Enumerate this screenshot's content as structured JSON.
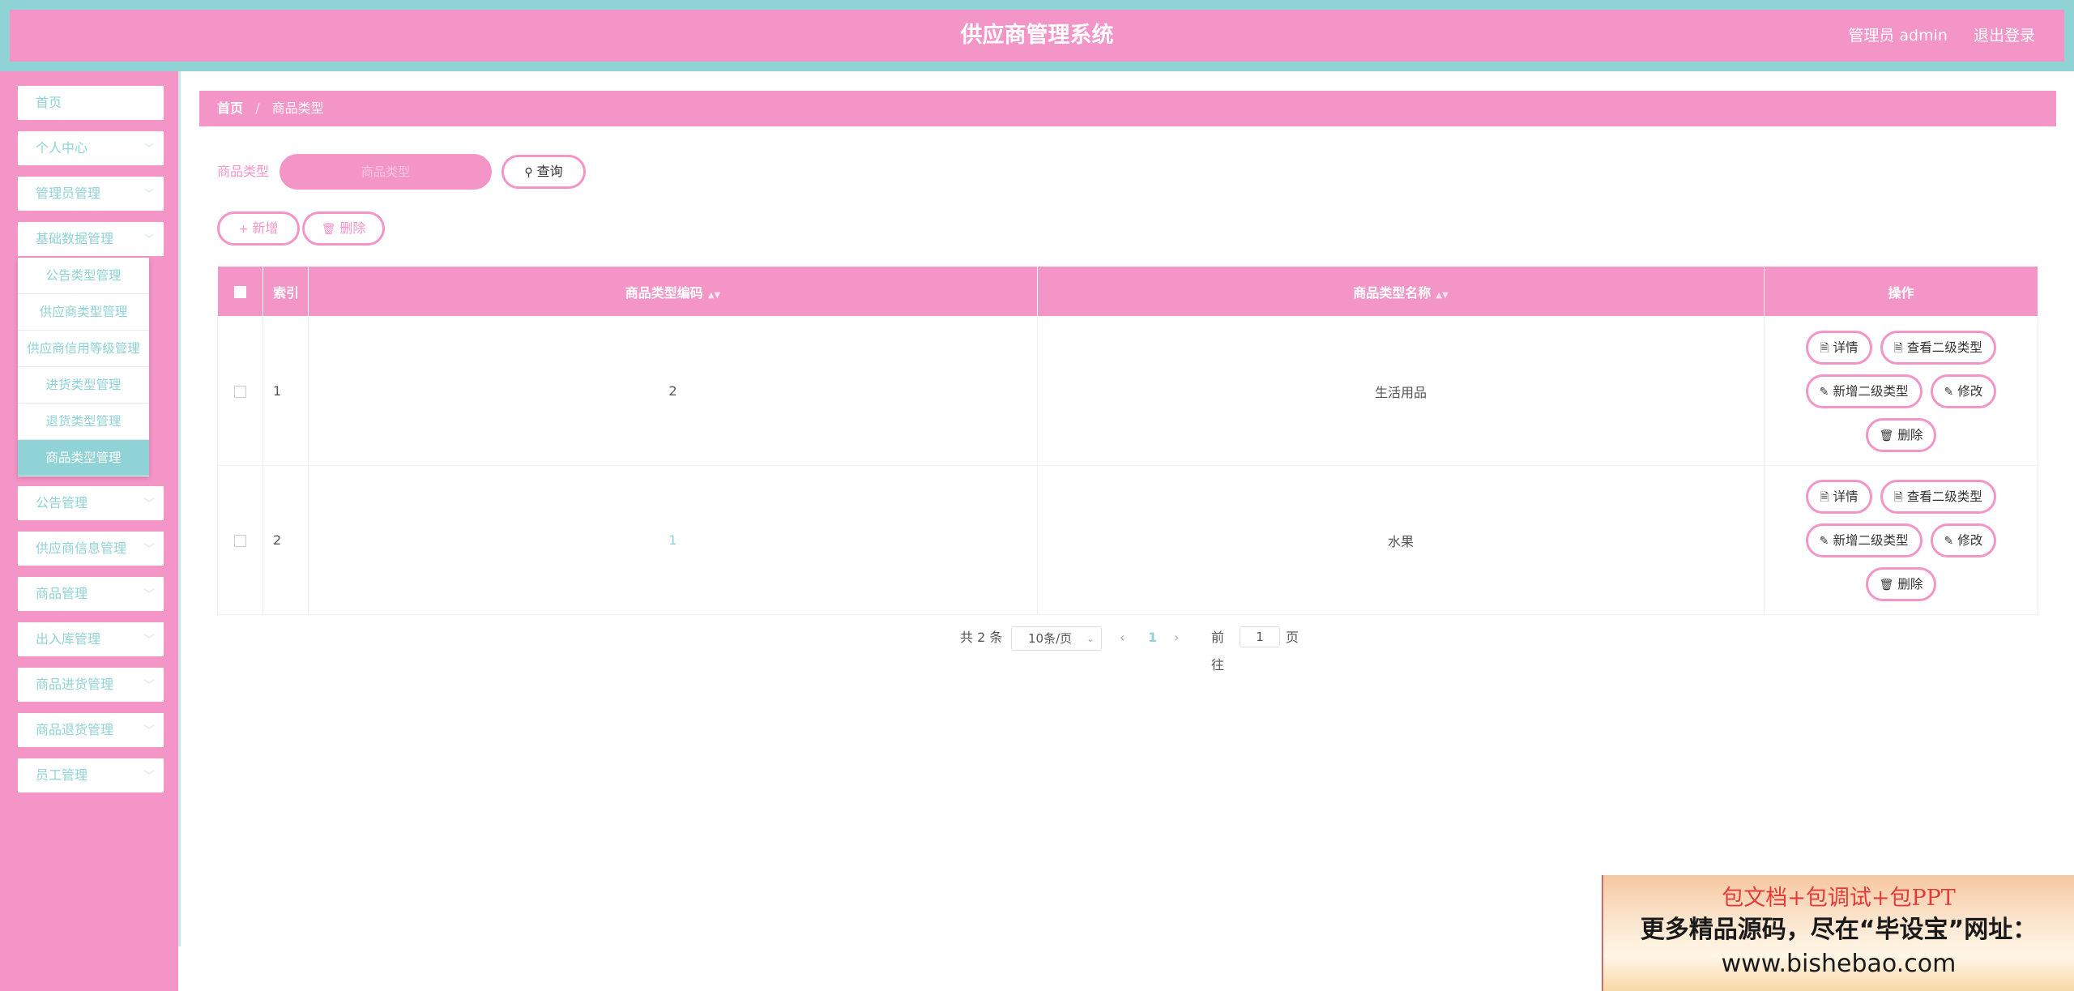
{
  "header": {
    "title": "供应商管理系统",
    "user_label": "管理员 admin",
    "logout": "退出登录"
  },
  "sidebar": {
    "items": [
      {
        "label": "首页",
        "chevron": ""
      },
      {
        "label": "个人中心",
        "chevron": "﹀"
      },
      {
        "label": "管理员管理",
        "chevron": "﹀"
      },
      {
        "label": "基础数据管理",
        "chevron": "﹀"
      },
      {
        "label": "公告管理",
        "chevron": "﹀"
      },
      {
        "label": "供应商信息管理",
        "chevron": "﹀"
      },
      {
        "label": "商品管理",
        "chevron": "﹀"
      },
      {
        "label": "出入库管理",
        "chevron": "﹀"
      },
      {
        "label": "商品进货管理",
        "chevron": "﹀"
      },
      {
        "label": "商品退货管理",
        "chevron": "﹀"
      },
      {
        "label": "员工管理",
        "chevron": "﹀"
      }
    ],
    "submenu": [
      "公告类型管理",
      "供应商类型管理",
      "供应商信用等级管理",
      "进货类型管理",
      "退货类型管理",
      "商品类型管理"
    ]
  },
  "breadcrumb": {
    "home": "首页",
    "separator": "/",
    "current": "商品类型"
  },
  "search": {
    "label": "商品类型",
    "placeholder": "商品类型",
    "query": "查询"
  },
  "actions": {
    "add": "新增",
    "delete": "删除"
  },
  "table": {
    "headers": {
      "index": "索引",
      "code": "商品类型编码",
      "name": "商品类型名称",
      "ops": "操作"
    },
    "rows": [
      {
        "index": "1",
        "code": "2",
        "name": "生活用品"
      },
      {
        "index": "2",
        "code": "1",
        "name": "水果"
      }
    ],
    "op_labels": {
      "detail": "详情",
      "view_sub": "查看二级类型",
      "add_sub": "新增二级类型",
      "edit": "修改",
      "delete": "删除"
    }
  },
  "pagination": {
    "total": "共 2 条",
    "page_size": "10条/页",
    "current_page": "1",
    "goto_label": "前往",
    "goto_value": "1",
    "page_suffix": "页"
  },
  "promo": {
    "line1": "包文档+包调试+包PPT",
    "line2": "更多精品源码，尽在“毕设宝”网址：",
    "line3": "www.bishebao.com"
  },
  "colors": {
    "pink": "#f395c7",
    "teal": "#8fd3d6"
  }
}
